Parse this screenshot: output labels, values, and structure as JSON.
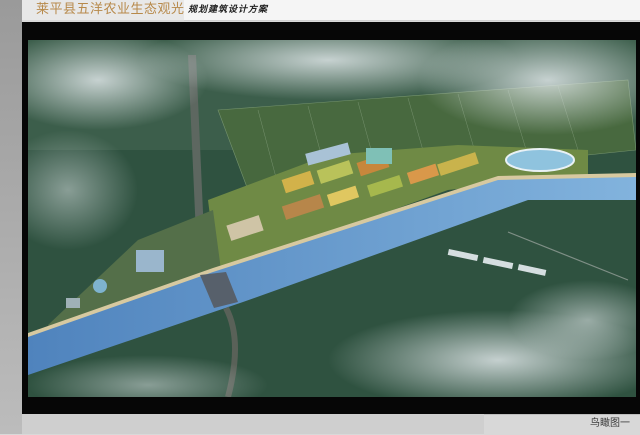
{
  "header": {
    "title": "莱平县五洋农业生态观光园",
    "subtitle": "规划建筑设计方案"
  },
  "image": {
    "icon": "aerial-rendering",
    "colors": {
      "forest": "#2f5240",
      "river": "#5b8fc4",
      "fields": "#c9a74a",
      "fog": "#c9d3d6"
    }
  },
  "footer": {
    "caption": "鸟瞰图一"
  }
}
